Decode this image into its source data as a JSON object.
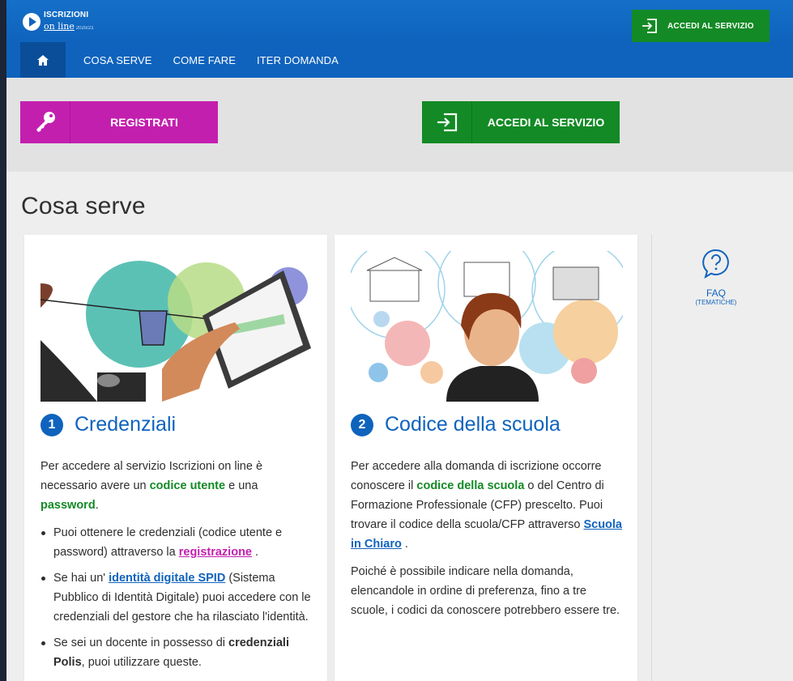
{
  "header": {
    "logo_line1": "ISCRIZIONI",
    "logo_line2": "on line",
    "logo_year": "2020/21",
    "top_button": "ACCEDI AL SERVIZIO"
  },
  "nav": {
    "items": [
      "COSA SERVE",
      "COME FARE",
      "ITER DOMANDA"
    ]
  },
  "actions": {
    "register": "REGISTRATI",
    "access": "ACCEDI AL SERVIZIO"
  },
  "page": {
    "title": "Cosa serve"
  },
  "card1": {
    "number": "1",
    "title": "Credenziali",
    "p1_a": "Per accedere al servizio Iscrizioni on line è necessario avere un ",
    "p1_b": "codice utente",
    "p1_c": " e una ",
    "p1_d": "password",
    "p1_e": ".",
    "li1_a": "Puoi ottenere le credenziali (codice utente e password) attraverso la ",
    "li1_b": "registrazione",
    "li1_c": " .",
    "li2_a": "Se hai un' ",
    "li2_b": "identità digitale SPID",
    "li2_c": " (Sistema Pubblico di Identità Digitale) puoi accedere con le credenziali del gestore che ha rilasciato l'identità.",
    "li3_a": "Se sei un docente in possesso di ",
    "li3_b": "credenziali Polis",
    "li3_c": ", puoi utilizzare queste."
  },
  "card2": {
    "number": "2",
    "title": "Codice della scuola",
    "p1_a": "Per accedere alla domanda di iscrizione occorre conoscere il ",
    "p1_b": "codice della scuola",
    "p1_c": " o del Centro di Formazione Professionale (CFP) prescelto. Puoi trovare il codice della scuola/CFP attraverso ",
    "p1_d": "Scuola in Chiaro",
    "p1_e": " .",
    "p2": "Poiché è possibile indicare nella domanda, elencandole in ordine di preferenza, fino a tre scuole, i codici da conoscere potrebbero essere tre."
  },
  "faq": {
    "title": "FAQ",
    "subtitle": "(TEMATICHE)"
  },
  "colors": {
    "blue": "#0f63bd",
    "green": "#138a25",
    "magenta": "#c31fae"
  }
}
